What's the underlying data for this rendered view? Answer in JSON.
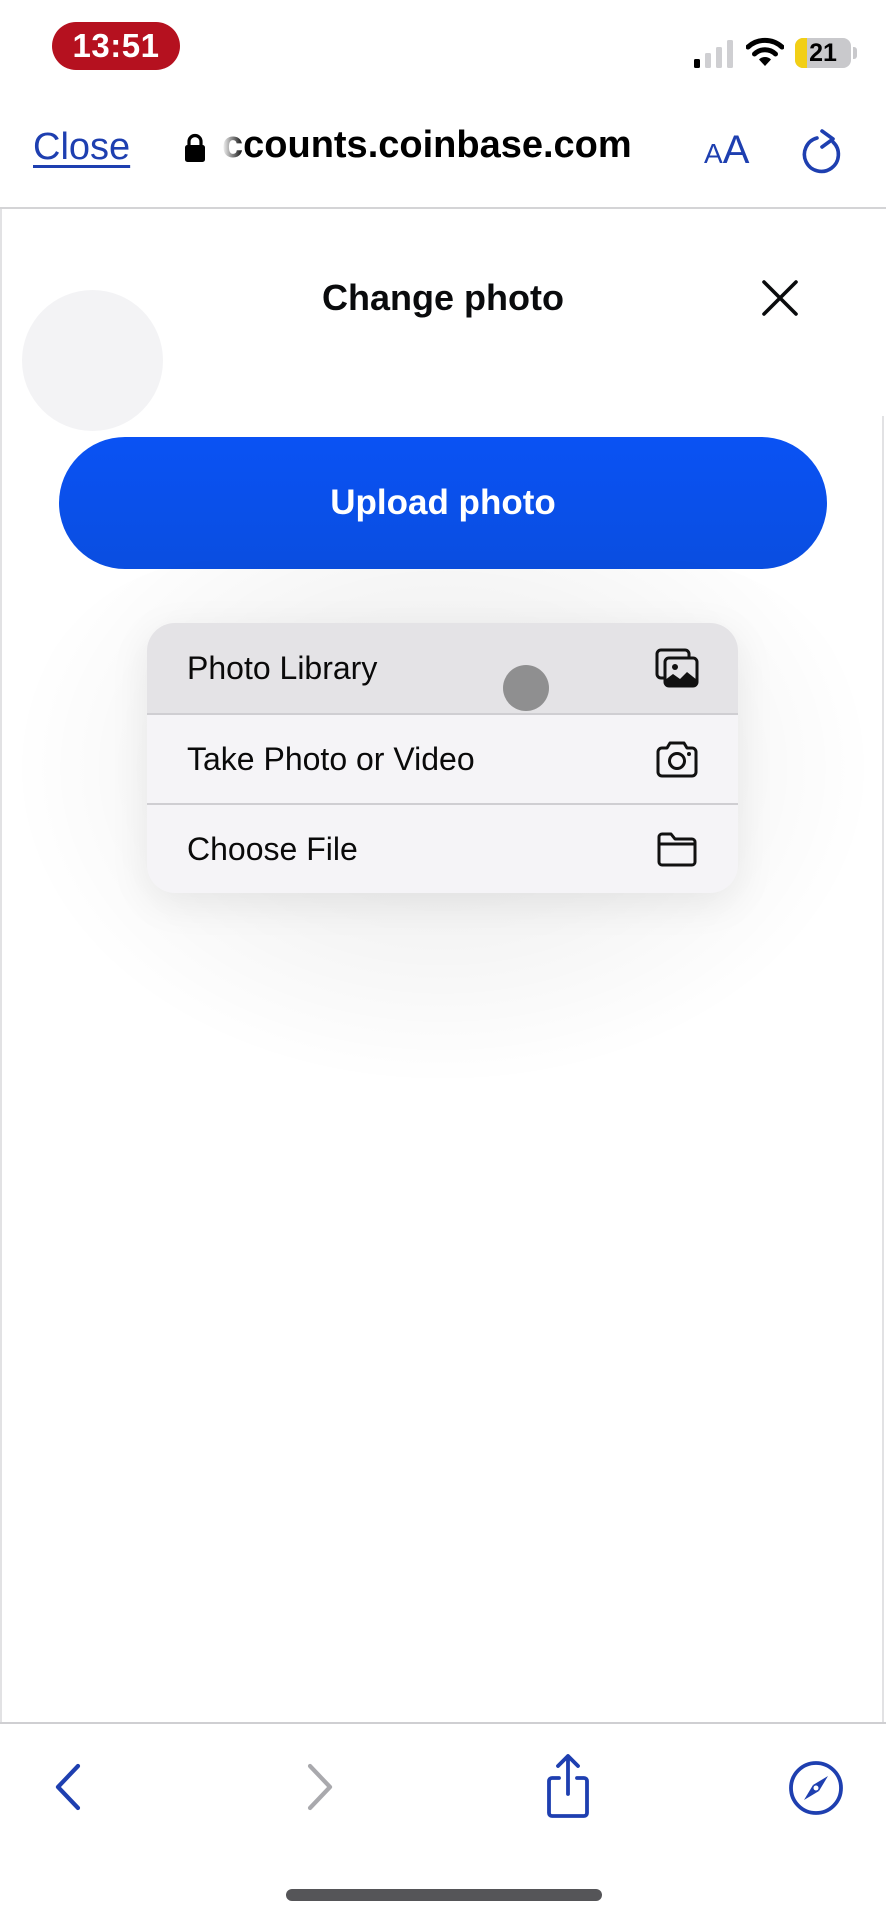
{
  "status_bar": {
    "time": "13:51",
    "time_pill_color": "#b5111f",
    "battery_level": "21",
    "battery_fill_fraction": 0.21,
    "battery_low_power_color": "#f2cf16",
    "icons": [
      "cellular-signal-icon",
      "wifi-icon",
      "battery-icon"
    ]
  },
  "browser_header": {
    "close_label": "Close",
    "url": "accounts.coinbase.com",
    "url_visible": "ccounts.coinbase.com",
    "text_size_small": "A",
    "text_size_big": "A",
    "accent_color": "#1e3fb0",
    "icons": [
      "lock-icon",
      "text-size-icon",
      "reload-icon"
    ]
  },
  "modal": {
    "title": "Change photo",
    "close_icon": "close-icon",
    "upload_button_label": "Upload photo",
    "brand_color": "#0a52f4"
  },
  "context_menu": {
    "items": [
      {
        "label": "Photo Library",
        "icon": "photo-library-icon",
        "highlighted": true
      },
      {
        "label": "Take Photo or Video",
        "icon": "camera-icon",
        "highlighted": false
      },
      {
        "label": "Choose File",
        "icon": "folder-icon",
        "highlighted": false
      }
    ]
  },
  "bottom_toolbar": {
    "items": [
      {
        "name": "back",
        "icon": "chevron-left-icon",
        "enabled": true
      },
      {
        "name": "forward",
        "icon": "chevron-right-icon",
        "enabled": false
      },
      {
        "name": "share",
        "icon": "share-icon",
        "enabled": true
      },
      {
        "name": "open-in-safari",
        "icon": "compass-icon",
        "enabled": true
      }
    ]
  }
}
